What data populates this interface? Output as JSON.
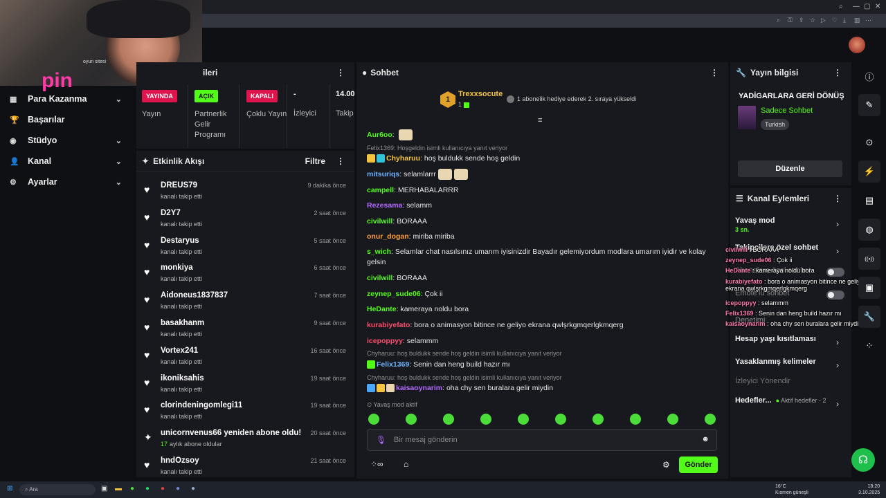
{
  "webcam": {
    "logo": "pin",
    "overlay_text": "oyun sitesi"
  },
  "nav": {
    "items": [
      {
        "label": "Para Kazanma",
        "icon": "money-icon",
        "chevron": true
      },
      {
        "label": "Başarılar",
        "icon": "trophy-icon",
        "chevron": false
      },
      {
        "label": "Stüdyo",
        "icon": "studio-icon",
        "chevron": true
      },
      {
        "label": "Kanal",
        "icon": "user-icon",
        "chevron": true
      },
      {
        "label": "Ayarlar",
        "icon": "gear-icon",
        "chevron": true
      }
    ]
  },
  "stream_panel": {
    "title_partial": "ileri",
    "stats": [
      {
        "pill": "YAYINDA",
        "pill_color": "#e0144c",
        "label": "Yayın"
      },
      {
        "pill": "AÇIK",
        "pill_color": "#53fc18",
        "label": "Partnerlik Gelir Programı"
      },
      {
        "pill": "KAPALI",
        "pill_color": "#e0144c",
        "label": "Çoklu Yayın"
      },
      {
        "value": "-",
        "label": "İzleyici"
      },
      {
        "value": "14.00",
        "label": "Takip"
      }
    ]
  },
  "activity": {
    "title": "Etkinlik Akışı",
    "filter_label": "Filtre",
    "items": [
      {
        "name": "DREUS79",
        "sub": "kanalı takip etti",
        "time": "9 dakika önce"
      },
      {
        "name": "D2Y7",
        "sub": "kanalı takip etti",
        "time": "2 saat önce"
      },
      {
        "name": "Destaryus",
        "sub": "kanalı takip etti",
        "time": "5 saat önce"
      },
      {
        "name": "monkiya",
        "sub": "kanalı takip etti",
        "time": "6 saat önce"
      },
      {
        "name": "Aidoneus1837837",
        "sub": "kanalı takip etti",
        "time": "7 saat önce"
      },
      {
        "name": "basakhanm",
        "sub": "kanalı takip etti",
        "time": "9 saat önce"
      },
      {
        "name": "Vortex241",
        "sub": "kanalı takip etti",
        "time": "16 saat önce"
      },
      {
        "name": "ikoniksahis",
        "sub": "kanalı takip etti",
        "time": "19 saat önce"
      },
      {
        "name": "clorindeningomlegi11",
        "sub": "kanalı takip etti",
        "time": "19 saat önce"
      },
      {
        "name": "unicornvenus66 yeniden abone oldu!",
        "sub_num": "17",
        "sub": "aylık abone oldular",
        "time": "20 saat önce"
      },
      {
        "name": "hndOzsoy",
        "sub": "kanalı takip etti",
        "time": "21 saat önce"
      }
    ]
  },
  "chat": {
    "title": "Sohbet",
    "pinned_user": "Trexxsocute",
    "pinned_rank": "1",
    "pinned_count": "1",
    "pinned_message": "1 abonelik hediye ederek 2. sıraya yükseldi",
    "messages": [
      {
        "user": "Aur6oo",
        "color": "#53fc18",
        "text": "",
        "emote": true
      },
      {
        "reply": "Felix1369: Hoşgeldin isimli kullanıcıya yanıt veriyor"
      },
      {
        "user": "Chyharuu",
        "color": "#f5c542",
        "text": "hoş buldukk sende hoş geldin"
      },
      {
        "user": "mitsuriqs",
        "color": "#6fb3ff",
        "text": "selamlarrr",
        "emote": true
      },
      {
        "user": "campell",
        "color": "#53fc18",
        "text": "MERHABALARRR"
      },
      {
        "user": "Rezesama",
        "color": "#b46cff",
        "text": "selamm"
      },
      {
        "user": "civilwill",
        "color": "#53fc18",
        "text": "BORAAA"
      },
      {
        "user": "onur_dogan",
        "color": "#ff9f3a",
        "text": "miriba miriba"
      },
      {
        "user": "s_wich",
        "color": "#53fc18",
        "text": "Selamlar chat nasılsınız umarım iyisinizdir Bayadır gelemiyordum modlara umarım iyidir ve kolay gelsin"
      },
      {
        "user": "civilwill",
        "color": "#53fc18",
        "text": "BORAAA"
      },
      {
        "user": "zeynep_sude06",
        "color": "#53fc18",
        "text": "Çok ii"
      },
      {
        "user": "HeDante",
        "color": "#53fc18",
        "text": "kameraya noldu bora"
      },
      {
        "user": "kurabiyefato",
        "color": "#ff4d6d",
        "text": "bora o animasyon bitince ne geliyo ekrana qwlşrkgmqerlgkmqerg"
      },
      {
        "user": "icepoppyy",
        "color": "#ff4d6d",
        "text": "selammm"
      },
      {
        "reply": "Chyharuu: hoş buldukk sende hoş geldin isimli kullanıcıya yanıt veriyor"
      },
      {
        "user": "Felix1369",
        "color": "#6fb3ff",
        "text": "Senin dan heng build hazır mı"
      },
      {
        "reply": "Chyharuu: hoş buldukk sende hoş geldin isimli kullanıcıya yanıt veriyor"
      },
      {
        "user": "kaisaoynarim",
        "color": "#b46cff",
        "text": "oha chy sen buralara gelir miydin"
      }
    ],
    "slow_mode_note": "Yavaş mod aktif",
    "input_placeholder": "Bir mesaj gönderin",
    "send_label": "Gönder"
  },
  "stream_info": {
    "title": "Yayın bilgisi",
    "stream_title": "YADİGARLARA GERİ DÖNÜŞ",
    "category": "Sadece Sohbet",
    "tag": "Turkish",
    "edit_label": "Düzenle"
  },
  "channel_actions": {
    "title": "Kanal Eylemleri",
    "items": [
      {
        "label": "Yavaş mod",
        "sub": "3 sn."
      },
      {
        "label": "Takipçilere özel sohbet"
      },
      {
        "label": "Abonelere özel sohbet"
      },
      {
        "label": "Emote'lu sohbet"
      },
      {
        "label": "Denetimi"
      },
      {
        "label": "Hesap yaşı kısıtlaması"
      },
      {
        "label": "Yasaklanmış kelimeler"
      },
      {
        "label": "İzleyici Yönendir"
      },
      {
        "label": "Hedefler...",
        "sub": "Aktif hedefler - 2"
      }
    ]
  },
  "overlay_chat": [
    {
      "user": "civilwill",
      "text": "BORAAA"
    },
    {
      "user": "zeynep_sude06",
      "text": "Çok ii"
    },
    {
      "user": "HeDante",
      "text": "kameraya noldu bora"
    },
    {
      "user": "kurabiyefato",
      "text": "bora o animasyon bitince ne geliyo ekrana qwlşrkgmqerlgkmqerg"
    },
    {
      "user": "icepoppyy",
      "text": "selammm"
    },
    {
      "user": "Felix1369",
      "text": "Senin dan heng build hazır mı"
    },
    {
      "user": "kaisaoynarim",
      "text": "oha chy sen buralara gelir miydin"
    }
  ],
  "taskbar": {
    "search": "Ara",
    "weather_temp": "16°C",
    "weather_desc": "Kısmen güneşli",
    "time": "18:20",
    "date": "3.10.2025"
  },
  "colors": {
    "accent": "#53fc18",
    "live": "#e0144c",
    "bg": "#0f1014",
    "panel": "#18191e"
  }
}
